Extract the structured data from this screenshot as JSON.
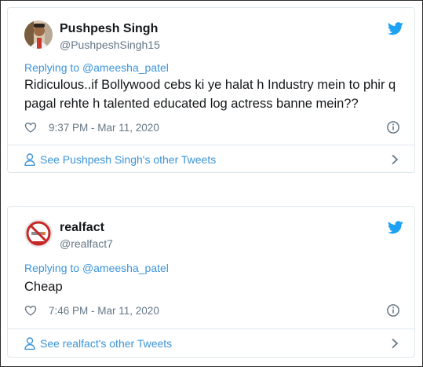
{
  "tweets": [
    {
      "name": "Pushpesh Singh",
      "handle": "@PushpeshSingh15",
      "replying_prefix": "Replying to",
      "replying_to": "@ameesha_patel",
      "text": "Ridiculous..if Bollywood cebs ki ye halat h Industry mein to phir q pagal rehte h talented educated log actress banne mein??",
      "time": "9:37 PM - Mar 11, 2020",
      "footer_link": "See Pushpesh Singh's other Tweets"
    },
    {
      "name": "realfact",
      "handle": "@realfact7",
      "replying_prefix": "Replying to",
      "replying_to": "@ameesha_patel",
      "text": "Cheap",
      "time": "7:46 PM - Mar 11, 2020",
      "footer_link": "See realfact's other Tweets"
    }
  ],
  "colors": {
    "link": "#3b94d9",
    "twitter_blue": "#1da1f2",
    "muted": "#657786",
    "border": "#e1e8ed"
  },
  "icons": {
    "brand": "twitter-bird-icon",
    "like": "heart-icon",
    "info": "info-icon",
    "profile": "user-icon",
    "more": "chevron-right-icon"
  }
}
